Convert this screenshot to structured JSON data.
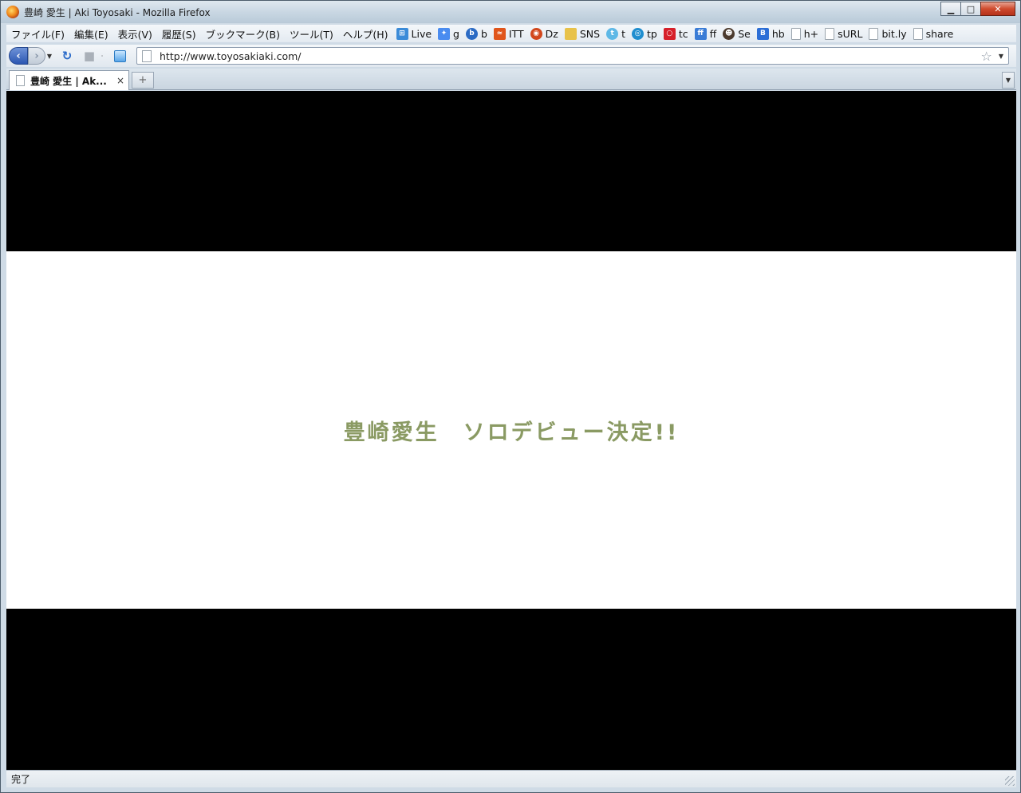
{
  "window": {
    "title": "豊崎 愛生 | Aki Toyosaki - Mozilla Firefox",
    "controls": {
      "minimize": "▁",
      "maximize": "□",
      "close": "✕"
    }
  },
  "menu": {
    "items": [
      "ファイル(F)",
      "編集(E)",
      "表示(V)",
      "履歴(S)",
      "ブックマーク(B)",
      "ツール(T)",
      "ヘルプ(H)"
    ]
  },
  "bookmarks": [
    {
      "label": "Live",
      "icon": "windows-live-icon",
      "color": "#3b8bd8"
    },
    {
      "label": "g",
      "icon": "google-icon",
      "color": "#4a8cf0"
    },
    {
      "label": "b",
      "icon": "bing-icon",
      "color": "#2b6bc4"
    },
    {
      "label": "ITT",
      "icon": "itt-icon",
      "color": "#e0551b"
    },
    {
      "label": "Dz",
      "icon": "dz-icon",
      "color": "#d2471c"
    },
    {
      "label": "SNS",
      "icon": "folder-icon",
      "color": "#e8c24a"
    },
    {
      "label": "t",
      "icon": "twitter-icon",
      "color": "#5eb8e6"
    },
    {
      "label": "tp",
      "icon": "tp-icon",
      "color": "#1f8ecf"
    },
    {
      "label": "tc",
      "icon": "tc-icon",
      "color": "#d6202a"
    },
    {
      "label": "ff",
      "icon": "friendfeed-icon",
      "color": "#3a7cd6"
    },
    {
      "label": "Se",
      "icon": "se-icon",
      "color": "#4c3b2e"
    },
    {
      "label": "hb",
      "icon": "hatena-bookmark-icon",
      "color": "#2c6ed6"
    },
    {
      "label": "h+",
      "icon": "page-icon",
      "color": "#ffffff"
    },
    {
      "label": "sURL",
      "icon": "page-icon",
      "color": "#ffffff"
    },
    {
      "label": "bit.ly",
      "icon": "page-icon",
      "color": "#ffffff"
    },
    {
      "label": "share",
      "icon": "page-icon",
      "color": "#ffffff"
    }
  ],
  "nav": {
    "back": "‹",
    "forward": "›",
    "url": "http://www.toyosakiaki.com/"
  },
  "tabs": {
    "active_label": "豊崎 愛生 | Ak...",
    "close": "×",
    "new_tab": "+"
  },
  "page": {
    "headline": "豊崎愛生　ソロデビュー決定!!",
    "headline_color": "#8a9a63"
  },
  "status": {
    "text": "完了"
  }
}
